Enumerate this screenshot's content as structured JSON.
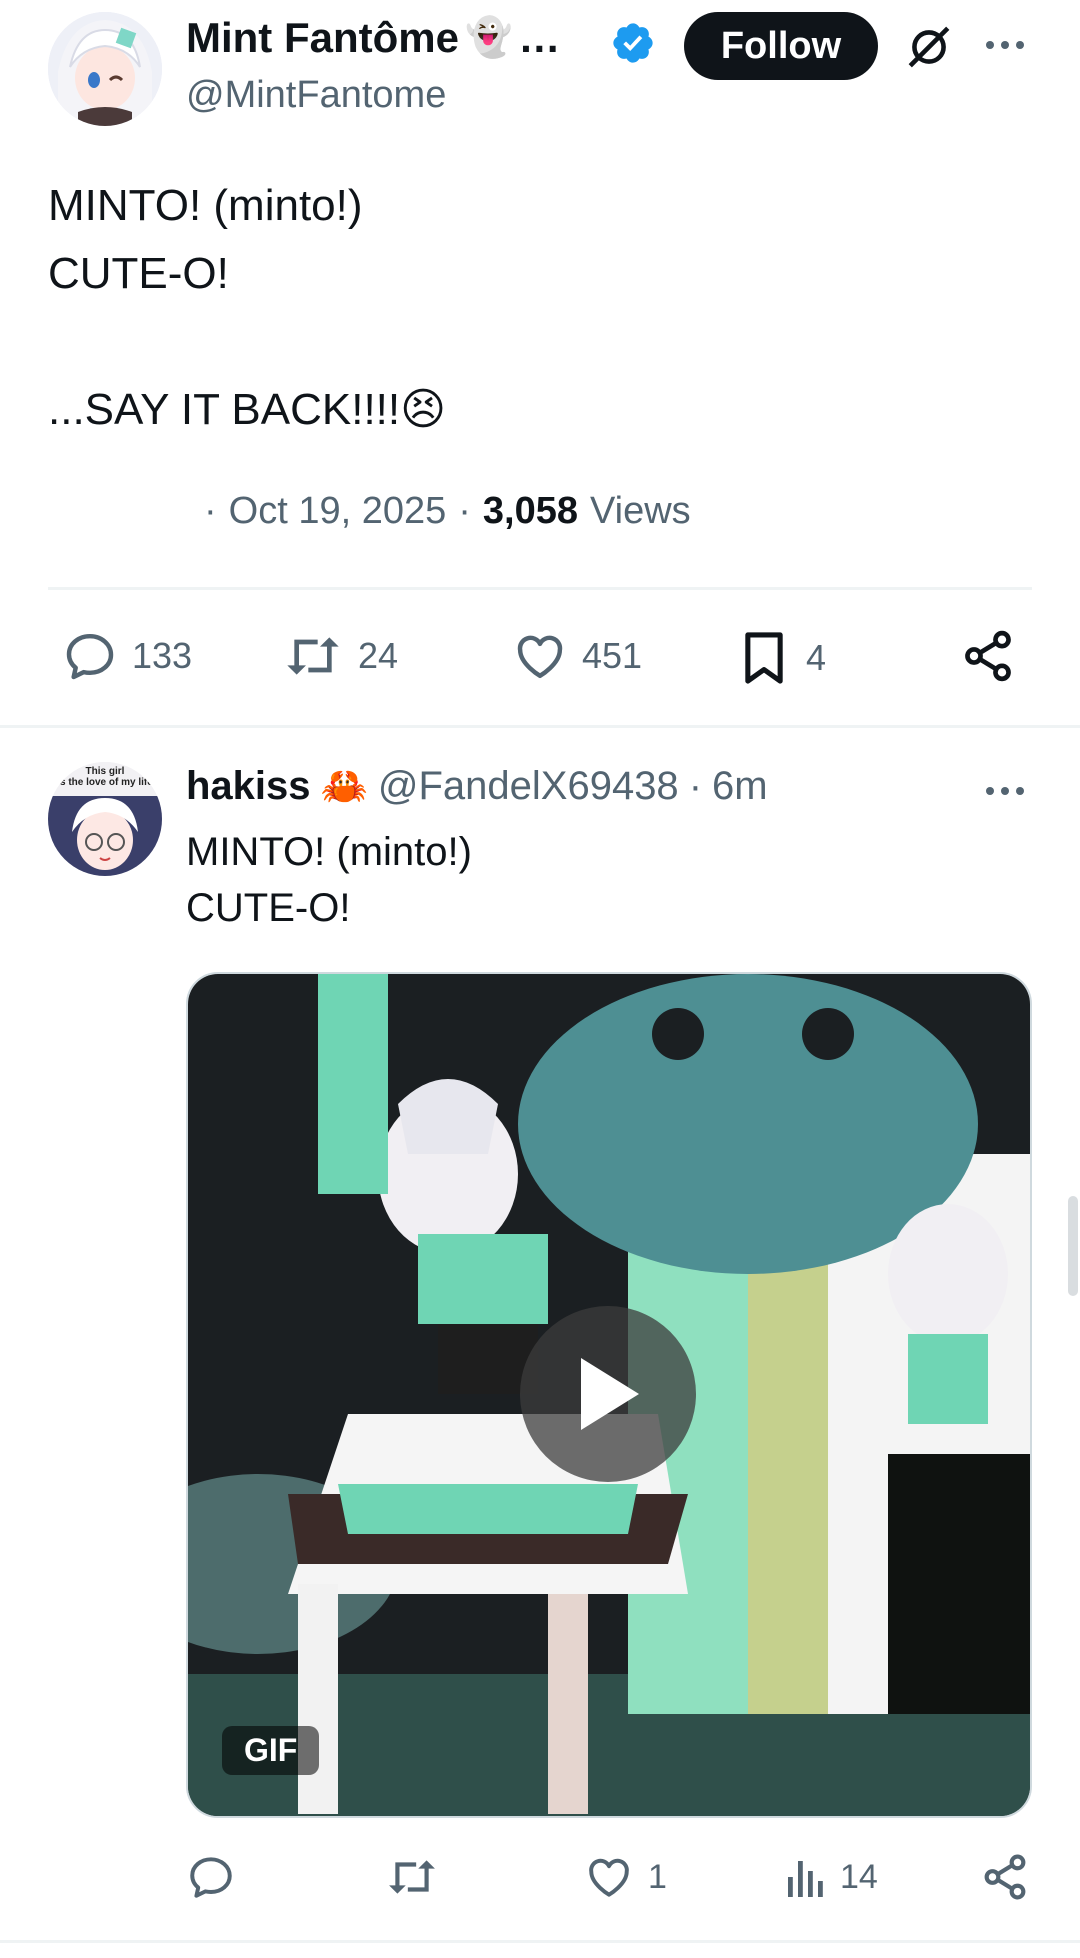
{
  "main_tweet": {
    "display_name": "Mint Fantôme",
    "name_emoji": "👻",
    "ellipsis": "…",
    "handle": "@MintFantome",
    "follow_label": "Follow",
    "text_lines": [
      "MINTO! (minto!)",
      "CUTE-O!",
      "",
      "...SAY IT BACK!!!!😣"
    ],
    "meta_sep": "·",
    "date": "Oct 19, 2025",
    "views_count": "3,058",
    "views_label": "Views",
    "replies": "133",
    "reposts": "24",
    "likes": "451",
    "bookmarks": "4"
  },
  "reply_tweet": {
    "display_name": "hakiss",
    "name_emoji": "🦀",
    "handle": "@FandelX69438",
    "time_sep": "·",
    "time": "6m",
    "text_lines": [
      "MINTO! (minto!)",
      "CUTE-O!"
    ],
    "gif_label": "GIF",
    "likes": "1",
    "views": "14",
    "avatar_caption_1": "This girl",
    "avatar_caption_2": "is the love of my life"
  },
  "colors": {
    "verified": "#1d9bf0",
    "text": "#0f1419",
    "gray": "#536471",
    "divider": "#eff3f4"
  }
}
